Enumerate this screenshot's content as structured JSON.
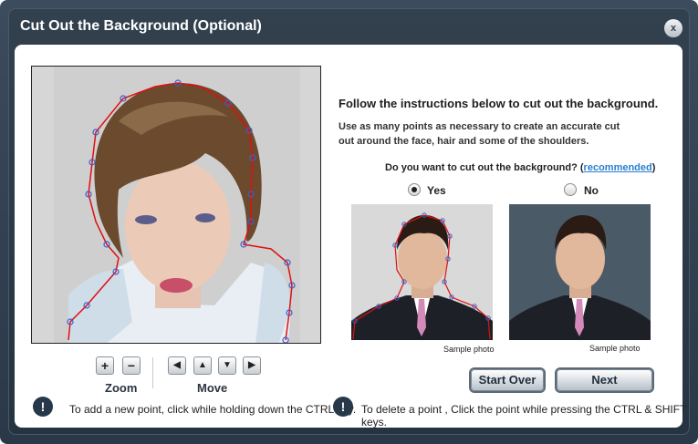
{
  "dialog": {
    "title": "Cut Out the Background (Optional)",
    "close_label": "x"
  },
  "controls": {
    "zoom_in": "+",
    "zoom_out": "−",
    "zoom_label": "Zoom",
    "move_left": "◀",
    "move_up": "▲",
    "move_down": "▼",
    "move_right": "▶",
    "move_label": "Move"
  },
  "instructions": {
    "heading": "Follow the instructions below to cut out the background.",
    "description": "Use as many points as necessary to create an accurate cut out around the face, hair and some of the shoulders.",
    "question_prefix": "Do you  want to cut out the background? (",
    "question_link": "recommended",
    "question_suffix": ")"
  },
  "options": {
    "yes_label": "Yes",
    "no_label": "No",
    "selected": "Yes"
  },
  "samples": {
    "caption_left": "Sample photo",
    "caption_right": "Sample photo"
  },
  "buttons": {
    "start_over": "Start Over",
    "next": "Next"
  },
  "tips": {
    "add_point": "To add a new point, click while holding down the CTRL key.",
    "delete_point": "To delete a point , Click the point while pressing the CTRL & SHIFT keys.",
    "icon_glyph": "!"
  },
  "colors": {
    "outline": "#e01010",
    "control_point": "#3a5fd0",
    "dialog_frame": "#2f3d4b"
  }
}
